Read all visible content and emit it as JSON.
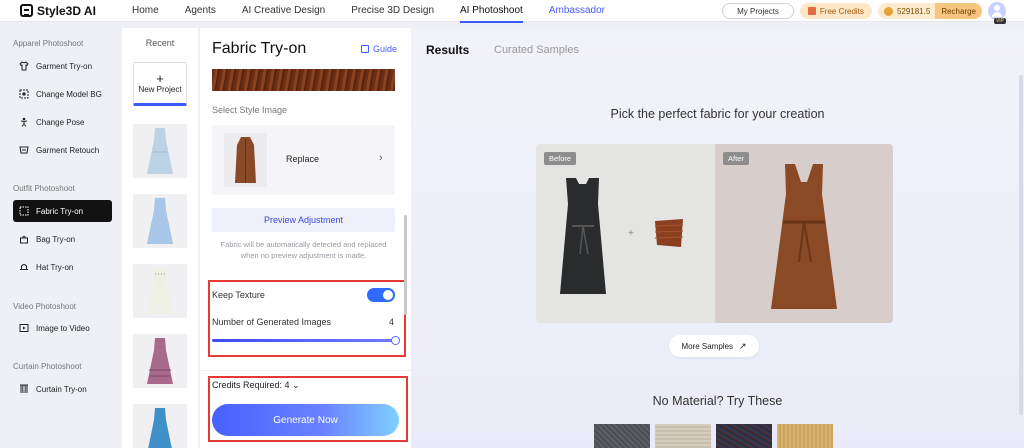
{
  "nav": {
    "logo": "Style3D AI",
    "items": [
      "Home",
      "Agents",
      "AI Creative Design",
      "Precise 3D Design",
      "AI Photoshoot",
      "Ambassador"
    ],
    "my_projects": "My Projects",
    "free_credits": "Free Credits",
    "balance": "529181.5",
    "recharge": "Recharge",
    "vip": "VIP"
  },
  "sidebar": {
    "sections": [
      {
        "title": "Apparel Photoshoot",
        "items": [
          {
            "label": "Garment Try-on",
            "icon": "shirt-icon"
          },
          {
            "label": "Change Model BG",
            "icon": "background-icon"
          },
          {
            "label": "Change Pose",
            "icon": "pose-icon"
          },
          {
            "label": "Garment Retouch",
            "icon": "retouch-icon"
          }
        ]
      },
      {
        "title": "Outfit Photoshoot",
        "items": [
          {
            "label": "Fabric Try-on",
            "icon": "fabric-icon",
            "active": true
          },
          {
            "label": "Bag Try-on",
            "icon": "bag-icon"
          },
          {
            "label": "Hat Try-on",
            "icon": "hat-icon"
          }
        ]
      },
      {
        "title": "Video Photoshoot",
        "items": [
          {
            "label": "Image to Video",
            "icon": "play-icon"
          }
        ]
      },
      {
        "title": "Curtain Photoshoot",
        "items": [
          {
            "label": "Curtain Try-on",
            "icon": "curtain-icon"
          }
        ]
      }
    ]
  },
  "recent": {
    "title": "Recent",
    "new_project": "New Project",
    "plus": "+"
  },
  "config": {
    "title": "Fabric Try-on",
    "guide": "Guide",
    "select_style_label": "Select Style Image",
    "replace": "Replace",
    "chevron": "›",
    "preview_button": "Preview Adjustment",
    "hint": "Fabric will be automatically detected and replaced when no preview adjustment is made.",
    "keep_texture": "Keep Texture",
    "keep_texture_on": true,
    "num_images_label": "Number of Generated Images",
    "num_images": "4",
    "credits_required": "Credits Required: 4",
    "credits_chevron": "⌄",
    "generate": "Generate Now"
  },
  "results": {
    "tab_results": "Results",
    "tab_curated": "Curated Samples",
    "heading": "Pick the perfect fabric for your creation",
    "before_tag": "Before",
    "after_tag": "After",
    "plus": "+",
    "more_samples": "More Samples",
    "more_arrow": "↗",
    "no_material": "No Material? Try These"
  },
  "colors": {
    "accent": "#3b5bff",
    "toggle": "#2f6bff",
    "highlight_box": "#e53935",
    "fabric_brown": "#8a4322"
  }
}
